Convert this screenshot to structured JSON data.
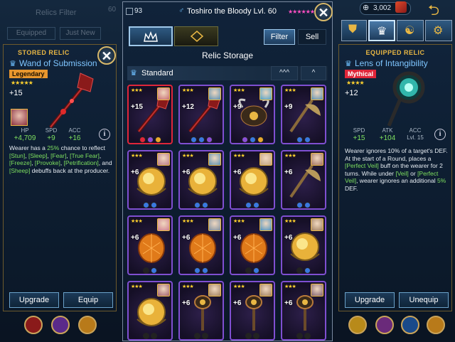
{
  "top": {
    "count": "93",
    "hero_name": "Toshiro the Bloody Lvl. 60",
    "currency": "3,002",
    "left_count": "60"
  },
  "left_filter": {
    "title": "Relics Filter",
    "equipped": "Equipped",
    "just_new": "Just New"
  },
  "stored": {
    "header": "STORED RELIC",
    "name": "Wand of Submission",
    "rarity": "Legendary",
    "level": "+15",
    "stats": [
      {
        "label": "HP",
        "value": "+4,709"
      },
      {
        "label": "SPD",
        "value": "+9"
      },
      {
        "label": "ACC",
        "value": "+16"
      }
    ],
    "desc_parts": [
      {
        "t": "Wearer has a ",
        "hl": false
      },
      {
        "t": "25%",
        "hl": true
      },
      {
        "t": " chance to reflect ",
        "hl": false
      },
      {
        "t": "[Stun]",
        "hl": true
      },
      {
        "t": ", ",
        "hl": false
      },
      {
        "t": "[Sleep]",
        "hl": true
      },
      {
        "t": ", ",
        "hl": false
      },
      {
        "t": "[Fear]",
        "hl": true
      },
      {
        "t": ", ",
        "hl": false
      },
      {
        "t": "[True Fear]",
        "hl": true
      },
      {
        "t": ", ",
        "hl": false
      },
      {
        "t": "[Freeze]",
        "hl": true
      },
      {
        "t": ", ",
        "hl": false
      },
      {
        "t": "[Provoke]",
        "hl": true
      },
      {
        "t": ", ",
        "hl": false
      },
      {
        "t": "[Petrification]",
        "hl": true
      },
      {
        "t": ", and ",
        "hl": false
      },
      {
        "t": "[Sheep]",
        "hl": true
      },
      {
        "t": " debuffs back at the producer.",
        "hl": false
      }
    ],
    "upgrade": "Upgrade",
    "equip": "Equip"
  },
  "storage": {
    "title": "Relic Storage",
    "filter": "Filter",
    "sell": "Sell",
    "section": "Standard",
    "collapse_all": "^^^",
    "collapse": "^",
    "cells": [
      {
        "level": "+15",
        "kind": "wand",
        "sel": true,
        "dots": [
          "#e0263a",
          "#8a4fd8",
          "#e9a92e"
        ],
        "por": "#c76b72"
      },
      {
        "level": "+12",
        "kind": "wand",
        "sel": false,
        "dots": [
          "#3a78e0",
          "#3a78e0",
          "#8a4fd8"
        ],
        "por": "#5a8fb0"
      },
      {
        "level": "+9",
        "kind": "horn",
        "sel": false,
        "dots": [
          "#8a4fd8",
          "#3a78e0",
          "#e9a92e"
        ],
        "por": "#4aa0c8"
      },
      {
        "level": "+9",
        "kind": "bird",
        "sel": false,
        "dots": [
          "#3a78e0",
          "#3a78e0"
        ],
        "por": "#5a8fb0"
      },
      {
        "level": "+6",
        "kind": "orb",
        "sel": false,
        "dots": [
          "#3a78e0",
          "#3a78e0"
        ],
        "por": "#b87a8a"
      },
      {
        "level": "+6",
        "kind": "orb",
        "sel": false,
        "dots": [
          "#3a78e0",
          "#3a78e0"
        ],
        "por": "#5a8fb0"
      },
      {
        "level": "+6",
        "kind": "orb",
        "sel": false,
        "dots": [
          "#3a78e0",
          "#3a78e0"
        ],
        "por": "#c0a080"
      },
      {
        "level": "+6",
        "kind": "bird",
        "sel": false,
        "dots": [
          "#3a78e0",
          "#3a78e0"
        ],
        "por": "#a07060"
      },
      {
        "level": "+6",
        "kind": "egg",
        "sel": false,
        "dots": [
          "#222",
          "#3a78e0"
        ],
        "por": "#d08090"
      },
      {
        "level": "+6",
        "kind": "egg",
        "sel": false,
        "dots": [
          "#3a78e0",
          "#3a78e0"
        ],
        "por": "#8090a0"
      },
      {
        "level": "+6",
        "kind": "egg",
        "sel": false,
        "dots": [
          "#222",
          "#3a78e0"
        ],
        "por": "#4a90c0"
      },
      {
        "level": "+6",
        "kind": "orb",
        "sel": false,
        "dots": [
          "#222",
          "#3a78e0"
        ],
        "por": "#a08060"
      },
      {
        "level": "",
        "kind": "orb",
        "sel": false,
        "dots": [
          "#222",
          "#222"
        ],
        "por": "#a06070"
      },
      {
        "level": "+6",
        "kind": "cross",
        "sel": false,
        "dots": [
          "#222",
          "#222"
        ],
        "por": "#a08060"
      },
      {
        "level": "+6",
        "kind": "cross",
        "sel": false,
        "dots": [
          "#222",
          "#222"
        ],
        "por": "#a08060"
      },
      {
        "level": "+6",
        "kind": "cross",
        "sel": false,
        "dots": [
          "#222",
          "#222"
        ],
        "por": "#806070"
      }
    ]
  },
  "equipped": {
    "header": "EQUIPPED RELIC",
    "name": "Lens of Intangibility",
    "rarity": "Mythical",
    "level": "+12",
    "stats": [
      {
        "label": "SPD",
        "value": "+15"
      },
      {
        "label": "ATK",
        "value": "+104"
      },
      {
        "label": "ACC",
        "value": "Lvl. 15"
      }
    ],
    "desc_parts": [
      {
        "t": "Wearer ignores 10% of a target's DEF. At the start of a Round, places a ",
        "hl": false
      },
      {
        "t": "[Perfect Veil]",
        "hl": true
      },
      {
        "t": " buff on the wearer for 2 turns. While under ",
        "hl": false
      },
      {
        "t": "[Veil]",
        "hl": true
      },
      {
        "t": " or ",
        "hl": false
      },
      {
        "t": "[Perfect Veil]",
        "hl": true
      },
      {
        "t": ", wearer ignores an additional ",
        "hl": false
      },
      {
        "t": "5%",
        "hl": true
      },
      {
        "t": " DEF.",
        "hl": false
      }
    ],
    "upgrade": "Upgrade",
    "unequip": "Unequip"
  },
  "colors": {
    "legendary": "#e8972e",
    "mythical": "#e0263a",
    "gold": "#e9b744",
    "green": "#7ee05f"
  }
}
